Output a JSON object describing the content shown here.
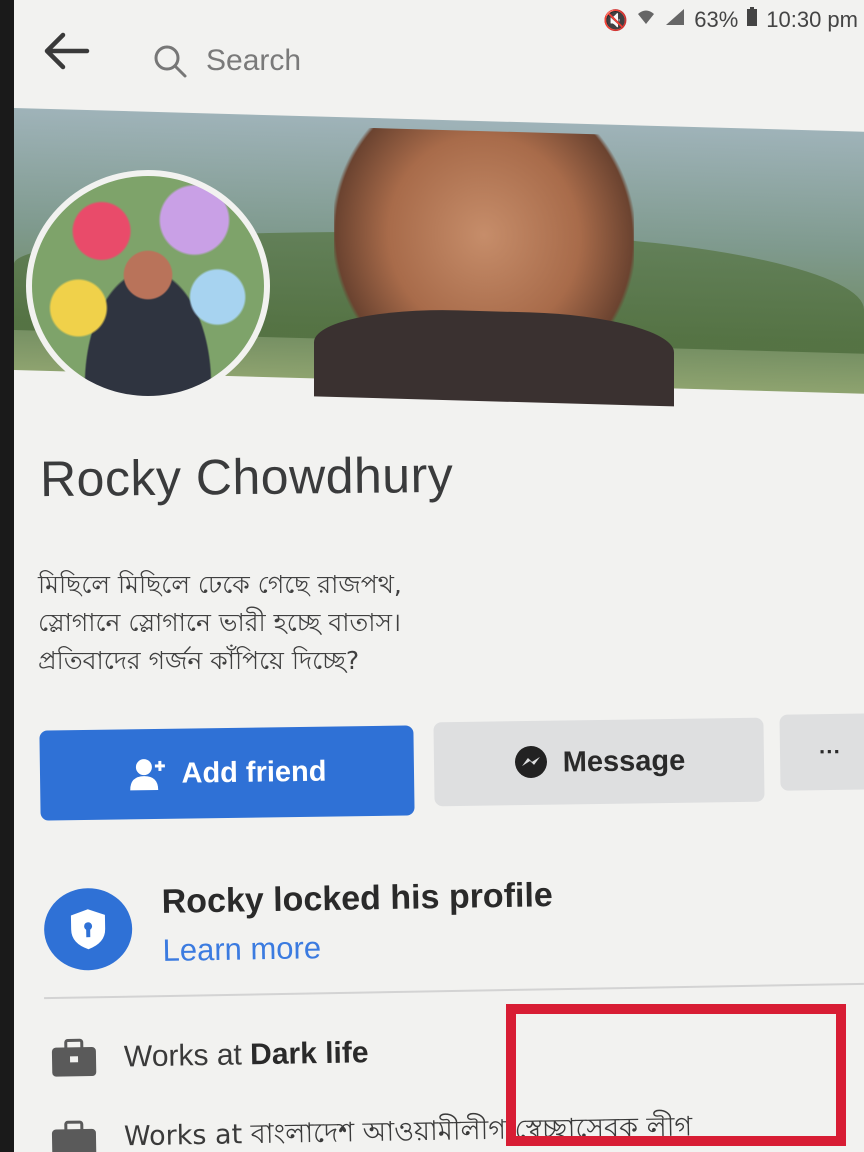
{
  "status_bar": {
    "battery": "63%",
    "time": "10:30 pm"
  },
  "search": {
    "placeholder": "Search"
  },
  "profile": {
    "name": "Rocky Chowdhury",
    "bio_lines": [
      "মিছিলে মিছিলে ঢেকে গেছে রাজপথ,",
      "স্লোগানে স্লোগানে ভারী হচ্ছে বাতাস।",
      "প্রতিবাদের গর্জন কাঁপিয়ে দিচ্ছে?"
    ]
  },
  "actions": {
    "add_friend": "Add friend",
    "message": "Message",
    "more": "···"
  },
  "locked": {
    "title": "Rocky locked his profile",
    "link": "Learn more"
  },
  "works": [
    {
      "prefix": "Works at",
      "place": "Dark life"
    },
    {
      "prefix": "Works at",
      "place": "বাংলাদেশ আওয়ামীলীগ স্বেচ্ছাসেবক লীগ"
    }
  ],
  "colors": {
    "accent": "#2f71d6",
    "highlight": "#d81d34"
  }
}
